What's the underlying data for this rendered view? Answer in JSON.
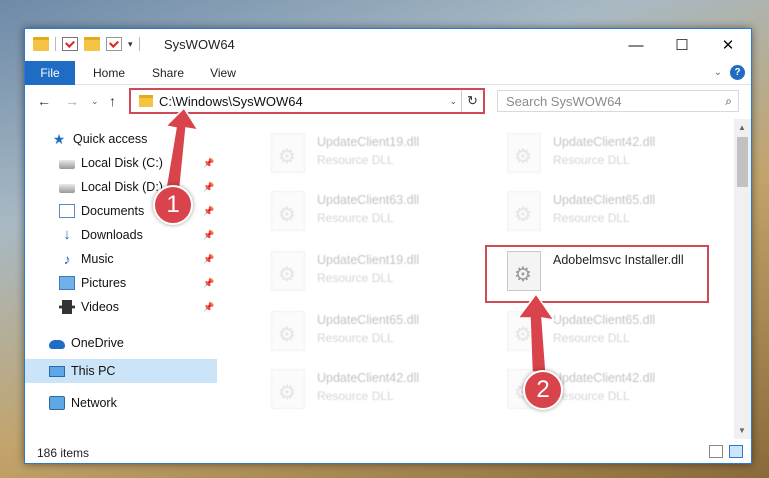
{
  "window": {
    "title": "SysWOW64",
    "controls": {
      "minimize": "—",
      "maximize": "☐",
      "close": "✕"
    },
    "qat_dropdown": "▾"
  },
  "ribbon": {
    "tabs": [
      "File",
      "Home",
      "Share",
      "View"
    ],
    "expand_glyph": "⌄",
    "help_glyph": "?"
  },
  "nav": {
    "back": "←",
    "forward": "→",
    "recent": "⌄",
    "up": "↑"
  },
  "address": {
    "path": "C:\\Windows\\SysWOW64",
    "dropdown": "⌄",
    "refresh": "↻"
  },
  "search": {
    "placeholder": "Search SysWOW64",
    "icon": "⌕"
  },
  "sidebar": {
    "items": [
      {
        "label": "Quick access",
        "icon": "star-icon"
      },
      {
        "label": "Local Disk (C:)",
        "icon": "drive-icon",
        "pinned": true
      },
      {
        "label": "Local Disk (D:)",
        "icon": "drive-icon",
        "pinned": true
      },
      {
        "label": "Documents",
        "icon": "documents-icon",
        "pinned": true
      },
      {
        "label": "Downloads",
        "icon": "download-icon",
        "pinned": true
      },
      {
        "label": "Music",
        "icon": "music-icon",
        "pinned": true
      },
      {
        "label": "Pictures",
        "icon": "pictures-icon",
        "pinned": true
      },
      {
        "label": "Videos",
        "icon": "videos-icon",
        "pinned": true
      },
      {
        "label": "OneDrive",
        "icon": "cloud-icon"
      },
      {
        "label": "This PC",
        "icon": "computer-icon",
        "selected": true
      },
      {
        "label": "Network",
        "icon": "network-icon"
      }
    ],
    "pin_glyph": "📌"
  },
  "files": [
    {
      "name": "UpdateClient19.dll",
      "type": "Resource DLL"
    },
    {
      "name": "UpdateClient42.dll",
      "type": "Resource DLL"
    },
    {
      "name": "UpdateClient63.dll",
      "type": "Resource DLL"
    },
    {
      "name": "UpdateClient65.dll",
      "type": "Resource DLL"
    },
    {
      "name": "UpdateClient19.dll",
      "type": "Resource DLL"
    },
    {
      "name": "Adobelmsvc Installer.dll",
      "type": ""
    },
    {
      "name": "UpdateClient65.dll",
      "type": "Resource DLL"
    },
    {
      "name": "UpdateClient65.dll",
      "type": "Resource DLL"
    },
    {
      "name": "UpdateClient42.dll",
      "type": "Resource DLL"
    },
    {
      "name": "UpdateClient42.dll",
      "type": "Resource DLL"
    }
  ],
  "status": {
    "item_count": "186 items"
  },
  "annotations": {
    "step1": "1",
    "step2": "2",
    "color": "#d9434b"
  }
}
